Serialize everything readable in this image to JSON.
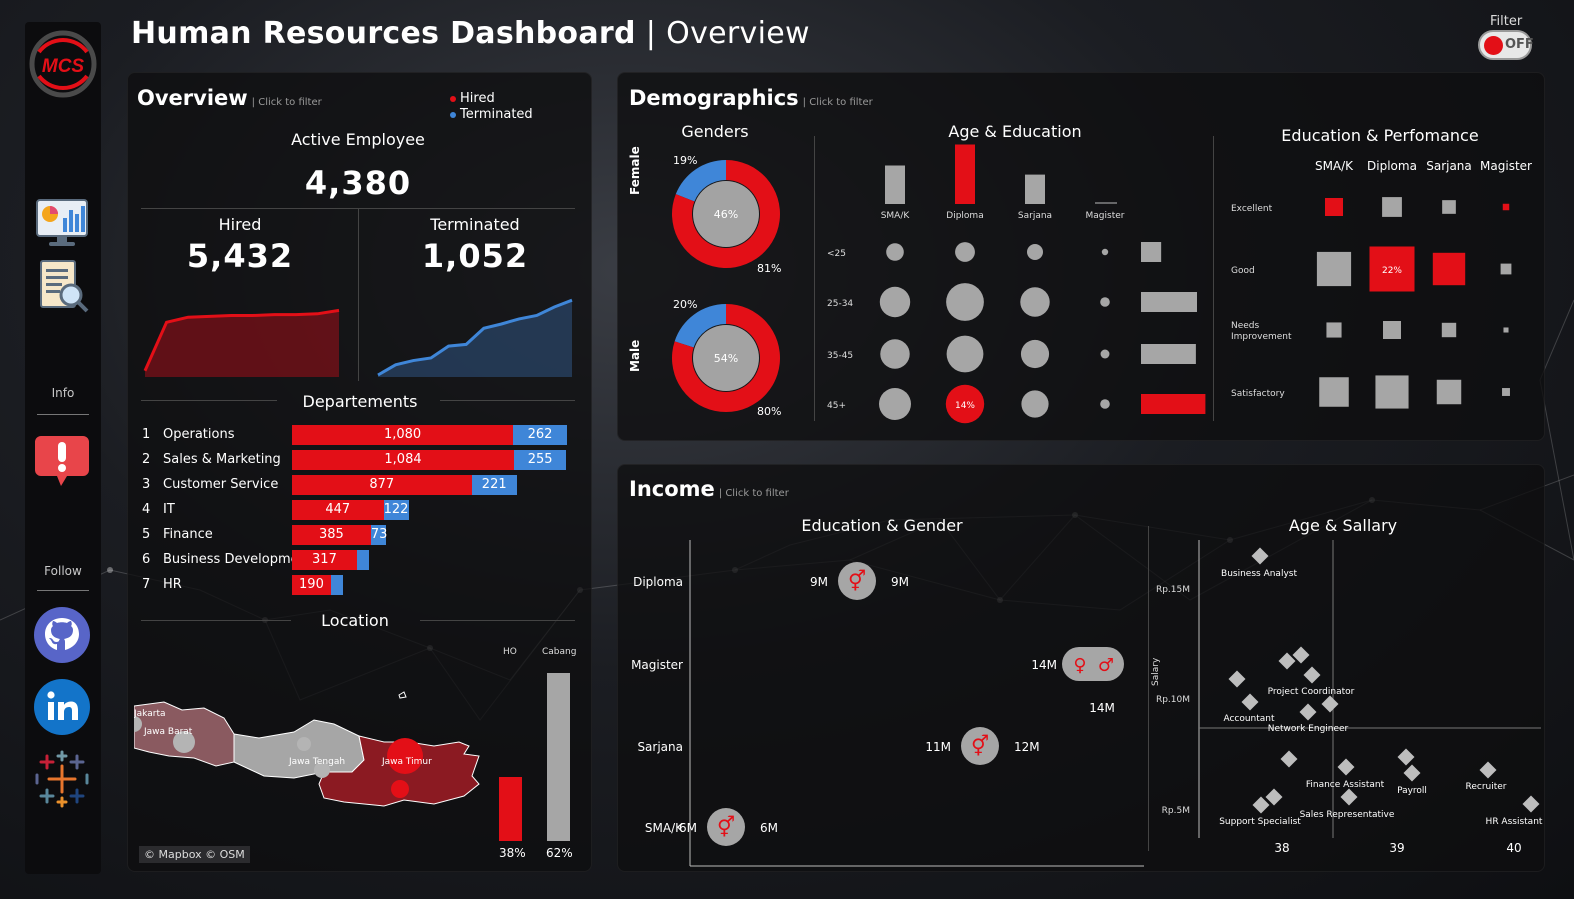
{
  "header": {
    "title": "Human Resources Dashboard",
    "separator": "|",
    "subtitle": "Overview",
    "filter_label": "Filter",
    "filter_state": "OFF"
  },
  "sidebar": {
    "logo": "MCS",
    "info_label": "Info",
    "follow_label": "Follow",
    "icons": [
      "dashboard-monitor-icon",
      "report-search-icon",
      "alert-info-icon",
      "github-icon",
      "linkedin-icon",
      "tableau-icon"
    ]
  },
  "overview": {
    "title": "Overview",
    "hint": "| Click to filter",
    "legend": [
      {
        "label": "Hired",
        "color": "#e30f17"
      },
      {
        "label": "Terminated",
        "color": "#3f86d8"
      }
    ],
    "active_label": "Active Employee",
    "active_value": "4,380",
    "hired_label": "Hired",
    "hired_value": "5,432",
    "terminated_label": "Terminated",
    "terminated_value": "1,052",
    "hired_trend": [
      0.05,
      0.62,
      0.68,
      0.69,
      0.7,
      0.7,
      0.71,
      0.71,
      0.72,
      0.76
    ],
    "terminated_trend": [
      0.0,
      0.12,
      0.17,
      0.2,
      0.34,
      0.36,
      0.55,
      0.6,
      0.66,
      0.7,
      0.8,
      0.88
    ]
  },
  "departments": {
    "title": "Departements",
    "rows": [
      {
        "rank": "1",
        "name": "Operations",
        "hired": 1080,
        "hired_label": "1,080",
        "terminated": 262,
        "terminated_label": "262"
      },
      {
        "rank": "2",
        "name": "Sales & Marketing",
        "hired": 1084,
        "hired_label": "1,084",
        "terminated": 255,
        "terminated_label": "255"
      },
      {
        "rank": "3",
        "name": "Customer Service",
        "hired": 877,
        "hired_label": "877",
        "terminated": 221,
        "terminated_label": "221"
      },
      {
        "rank": "4",
        "name": "IT",
        "hired": 447,
        "hired_label": "447",
        "terminated": 122,
        "terminated_label": "122"
      },
      {
        "rank": "5",
        "name": "Finance",
        "hired": 385,
        "hired_label": "385",
        "terminated": 73,
        "terminated_label": "73"
      },
      {
        "rank": "6",
        "name": "Business Development",
        "hired": 317,
        "hired_label": "317",
        "terminated": 60,
        "terminated_label": ""
      },
      {
        "rank": "7",
        "name": "HR",
        "hired": 190,
        "hired_label": "190",
        "terminated": 50,
        "terminated_label": ""
      }
    ]
  },
  "location": {
    "title": "Location",
    "labels": [
      "Jakarta",
      "Jawa Barat",
      "Jawa Tengah",
      "Jawa Timur"
    ],
    "ho_label": "HO",
    "cabang_label": "Cabang",
    "ho_pct": 38,
    "ho_pct_label": "38%",
    "cabang_pct": 62,
    "cabang_pct_label": "62%",
    "credit": "© Mapbox © OSM"
  },
  "demographics": {
    "title": "Demographics",
    "hint": "| Click to filter",
    "genders_title": "Genders",
    "female_label": "Female",
    "male_label": "Male",
    "female_outer": {
      "small": 19,
      "small_label": "19%",
      "large_label": "81%",
      "inner_label": "46%"
    },
    "male_outer": {
      "small": 20,
      "small_label": "20%",
      "large_label": "80%",
      "inner_label": "54%"
    },
    "age_edu_title": "Age & Education",
    "edu_levels": [
      "SMA/K",
      "Diploma",
      "Sarjana",
      "Magister"
    ],
    "edu_bar_values": [
      0.55,
      0.85,
      0.42,
      0.02
    ],
    "age_groups": [
      "<25",
      "25-34",
      "35-45",
      "45+"
    ],
    "bubble_sizes": [
      [
        0.55,
        0.62,
        0.5,
        0.2
      ],
      [
        0.95,
        1.18,
        0.92,
        0.3
      ],
      [
        0.92,
        1.15,
        0.88,
        0.28
      ],
      [
        1.0,
        1.2,
        0.85,
        0.3
      ]
    ],
    "highlight_label": "14%",
    "age_bar_values": [
      0.36,
      1.0,
      0.98,
      1.15
    ],
    "edu_perf_title": "Education & Perfomance",
    "perf_levels": [
      "Excellent",
      "Good",
      "Needs Improvement",
      "Satisfactory"
    ],
    "perf_sizes": [
      [
        0.5,
        0.55,
        0.38,
        0.18
      ],
      [
        0.95,
        1.25,
        0.9,
        0.3
      ],
      [
        0.42,
        0.5,
        0.4,
        0.14
      ],
      [
        0.82,
        0.92,
        0.68,
        0.22
      ]
    ],
    "perf_highlight_label": "22%"
  },
  "income": {
    "title": "Income",
    "hint": "| Click to filter",
    "edu_gender_title": "Education & Gender",
    "rows": [
      {
        "label": "Diploma",
        "left": "9M",
        "right": "9M",
        "icon": "⚥"
      },
      {
        "label": "Magister",
        "left": "14M",
        "right": "14M",
        "icon": "♀ ♂"
      },
      {
        "label": "Sarjana",
        "left": "11M",
        "right": "12M",
        "icon": "⚥"
      },
      {
        "label": "SMA/K",
        "left": "6M",
        "right": "6M",
        "icon": "⚥"
      }
    ],
    "age_salary_title": "Age & Sallary",
    "y_axis_label": "Salary",
    "y_ticks": [
      "Rp.15M",
      "Rp.10M",
      "Rp.5M"
    ],
    "x_ticks": [
      "38",
      "39",
      "40"
    ],
    "roles": [
      "Business Analyst",
      "Project Coordinator",
      "Accountant",
      "Network Engineer",
      "Finance Assistant",
      "Payroll",
      "Recruiter",
      "Sales Representative",
      "Support Specialist",
      "HR Assistant"
    ]
  }
}
